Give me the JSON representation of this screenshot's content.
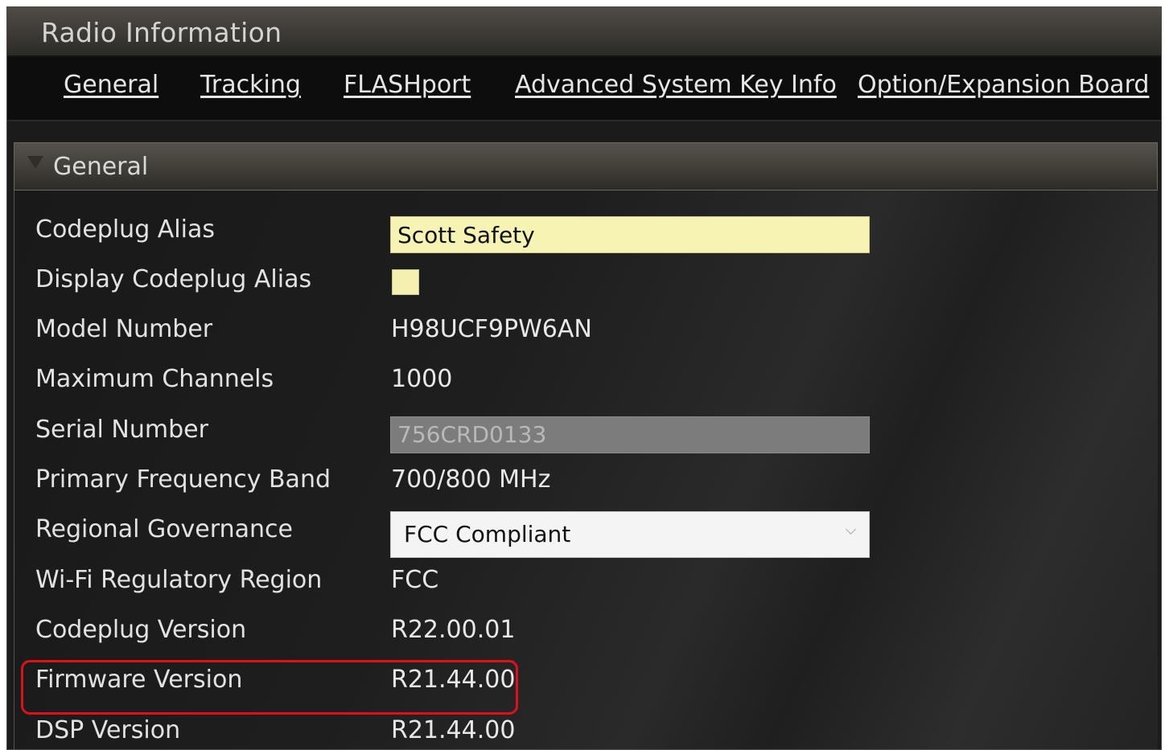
{
  "window": {
    "title": "Radio Information"
  },
  "tabs": [
    {
      "label": "General"
    },
    {
      "label": "Tracking"
    },
    {
      "label": "FLASHport"
    },
    {
      "label": "Advanced System Key Info"
    },
    {
      "label": "Option/Expansion Board"
    }
  ],
  "section": {
    "title": "General",
    "expanded": true
  },
  "fields": {
    "codeplug_alias": {
      "label": "Codeplug Alias",
      "value": "Scott Safety"
    },
    "display_codeplug_alias": {
      "label": "Display Codeplug Alias",
      "checked": false
    },
    "model_number": {
      "label": "Model Number",
      "value": "H98UCF9PW6AN"
    },
    "maximum_channels": {
      "label": "Maximum Channels",
      "value": "1000"
    },
    "serial_number": {
      "label": "Serial Number",
      "value": "756CRD0133"
    },
    "primary_frequency_band": {
      "label": "Primary Frequency Band",
      "value": "700/800 MHz"
    },
    "regional_governance": {
      "label": "Regional Governance",
      "value": "FCC Compliant"
    },
    "wifi_regulatory_region": {
      "label": "Wi-Fi Regulatory Region",
      "value": "FCC"
    },
    "codeplug_version": {
      "label": "Codeplug Version",
      "value": "R22.00.01"
    },
    "firmware_version": {
      "label": "Firmware Version",
      "value": "R21.44.00"
    },
    "dsp_version": {
      "label": "DSP Version",
      "value": "R21.44.00"
    }
  },
  "colors": {
    "input_background": "#f6f3b3",
    "highlight_outline": "#e0101a"
  }
}
